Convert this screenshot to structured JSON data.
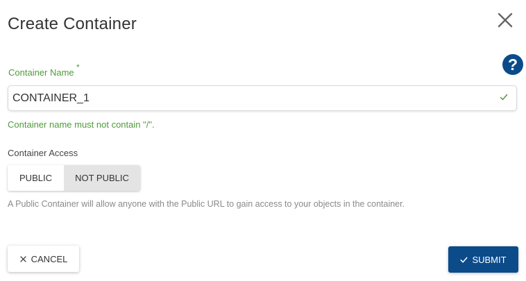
{
  "dialog": {
    "title": "Create Container",
    "close_icon": "close-icon",
    "help_icon": "question-circle-icon",
    "help_glyph": "?"
  },
  "name_field": {
    "label": "Container Name",
    "required_marker": "*",
    "value": "CONTAINER_1",
    "placeholder": "",
    "valid": true,
    "status_icon": "check-icon",
    "help_text": "Container name must not contain \"/\"."
  },
  "access": {
    "label": "Container Access",
    "options": [
      "PUBLIC",
      "NOT PUBLIC"
    ],
    "selected": "NOT PUBLIC",
    "description": "A Public Container will allow anyone with the Public URL to gain access to your objects in the container."
  },
  "actions": {
    "cancel_label": "CANCEL",
    "cancel_icon": "x-icon",
    "submit_label": "SUBMIT",
    "submit_icon": "check-icon"
  },
  "colors": {
    "primary": "#0c4b8a",
    "valid_green": "#4f9b3a",
    "selected_toggle_bg": "#e4e4e4"
  }
}
